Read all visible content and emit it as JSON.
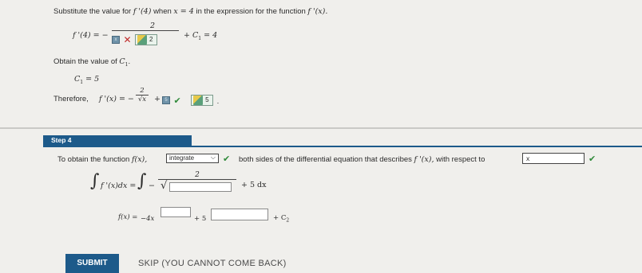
{
  "top": {
    "instruction_prefix": "Substitute the value for",
    "instruction_fprime4": "f '(4)",
    "instruction_when": "when",
    "instruction_xeq": "x = 4",
    "instruction_mid": "in the expression for the function",
    "instruction_fprimex": "f '(x).",
    "eq_lhs": "f '(4) = −",
    "eq_numerator": "2",
    "eq_den_small_box": "x",
    "eq_den_answer": "2",
    "eq_rhs": "+ C",
    "eq_rhs_sub": "1",
    "eq_rhs_tail": "= 4",
    "obtain_text": "Obtain the value of",
    "obtain_var": "C",
    "obtain_sub": "1",
    "obtain_tail": ".",
    "c1_lhs": "C",
    "c1_sub": "1",
    "c1_rhs": "= 5",
    "therefore_text": "Therefore,",
    "therefore_lhs": "f '(x) = −",
    "therefore_num": "2",
    "therefore_den": "√x",
    "therefore_plus": "+",
    "therefore_box": "5",
    "therefore_answer": "5",
    "therefore_period": "."
  },
  "step": {
    "label": "Step 4",
    "instruction_prefix": "To obtain the function",
    "instruction_fx": "f(x),",
    "select_value": "integrate",
    "instruction_mid": "both sides of the differential equation that describes",
    "instruction_fprime": "f '(x),",
    "instruction_wrt": "with respect to",
    "wrt_value": "x",
    "integral_lhs": "f '(x)dx =",
    "integral_neg": "−",
    "integral_num": "2",
    "integral_tail": "+ 5 dx",
    "fx_lhs": "f(x) =",
    "fx_coef": "−4x",
    "fx_plus1": "+ 5",
    "fx_plus2": "+ C",
    "fx_sub": "2"
  },
  "actions": {
    "submit": "SUBMIT",
    "skip": "SKIP (YOU CANNOT COME BACK)"
  },
  "colors": {
    "accent": "#1d5a8a",
    "check": "#2f8a3a",
    "wrong": "#c12a2a"
  }
}
